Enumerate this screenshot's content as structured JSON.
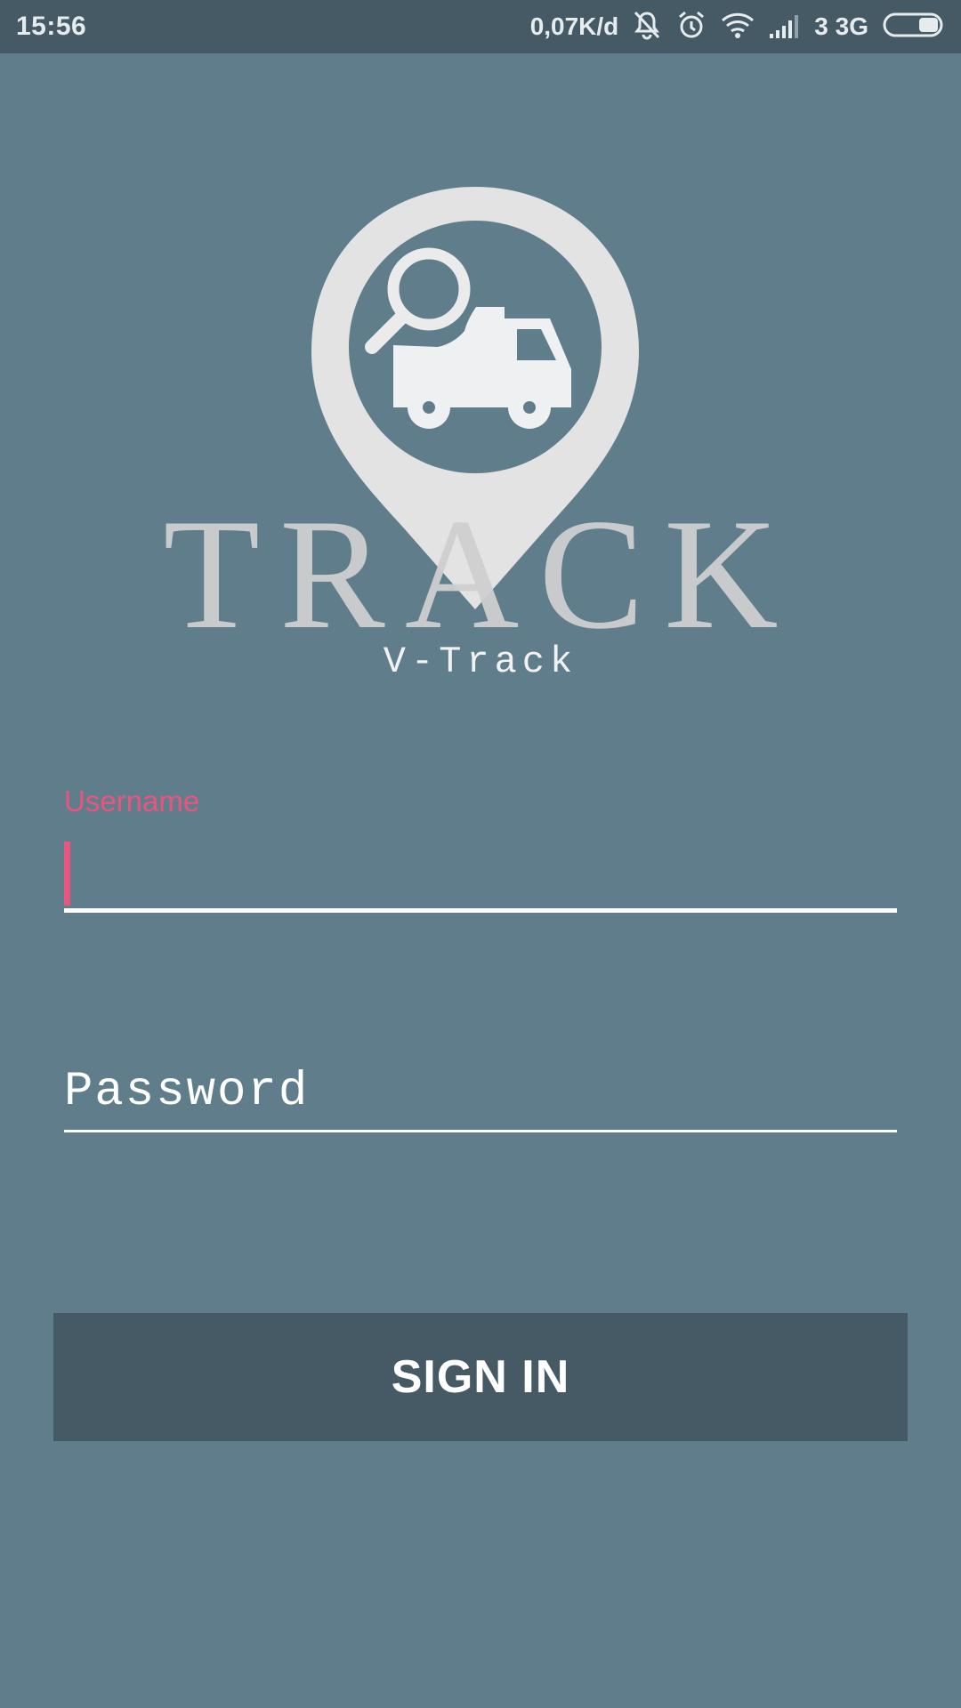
{
  "status_bar": {
    "time": "15:56",
    "speed": "0,07K/d",
    "network": "3 3G",
    "icons": [
      "vibrate-mute-icon",
      "alarm-icon",
      "wifi-icon",
      "signal-icon",
      "battery-icon"
    ]
  },
  "logo": {
    "wordmark": "TRACK",
    "icon": "map-pin-truck-search-icon",
    "caption": "V-Track"
  },
  "form": {
    "username": {
      "label": "Username",
      "value": ""
    },
    "password": {
      "placeholder": "Password",
      "value": ""
    },
    "submit_label": "SIGN IN"
  },
  "colors": {
    "background": "#607d8b",
    "status_bar": "#455a64",
    "button": "#455a64",
    "accent": "#e9557f",
    "logo": "#e0e0e0"
  }
}
